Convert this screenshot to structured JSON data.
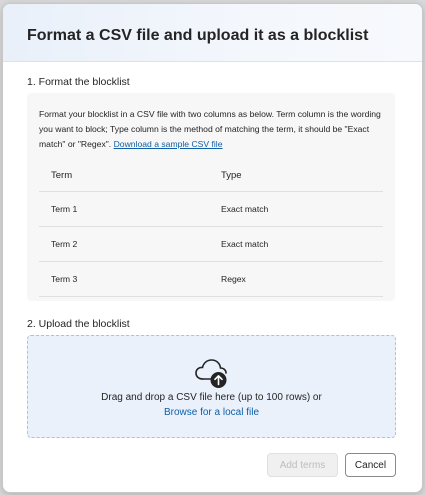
{
  "dialog": {
    "title": "Format a CSV file and upload it as a blocklist"
  },
  "format_section": {
    "title": "1. Format the blocklist",
    "description": "Format your blocklist in a CSV file with two columns as below. Term column is the wording you want to block; Type column is the method of matching the term, it should be \"Exact match\" or \"Regex\". ",
    "sample_link": "Download a sample CSV file",
    "table": {
      "headers": [
        "Term",
        "Type"
      ],
      "rows": [
        [
          "Term 1",
          "Exact match"
        ],
        [
          "Term 2",
          "Exact match"
        ],
        [
          "Term 3",
          "Regex"
        ]
      ]
    }
  },
  "upload_section": {
    "title": "2. Upload the blocklist",
    "drop_text": "Drag and drop a CSV file here (up to 100 rows) or",
    "browse_link": "Browse for a local file",
    "icon": "cloud-upload-icon"
  },
  "footer": {
    "add_label": "Add terms",
    "add_disabled": true,
    "cancel_label": "Cancel"
  },
  "colors": {
    "accent": "#0f5fa8",
    "dropzone_bg": "#ebf1fb"
  }
}
